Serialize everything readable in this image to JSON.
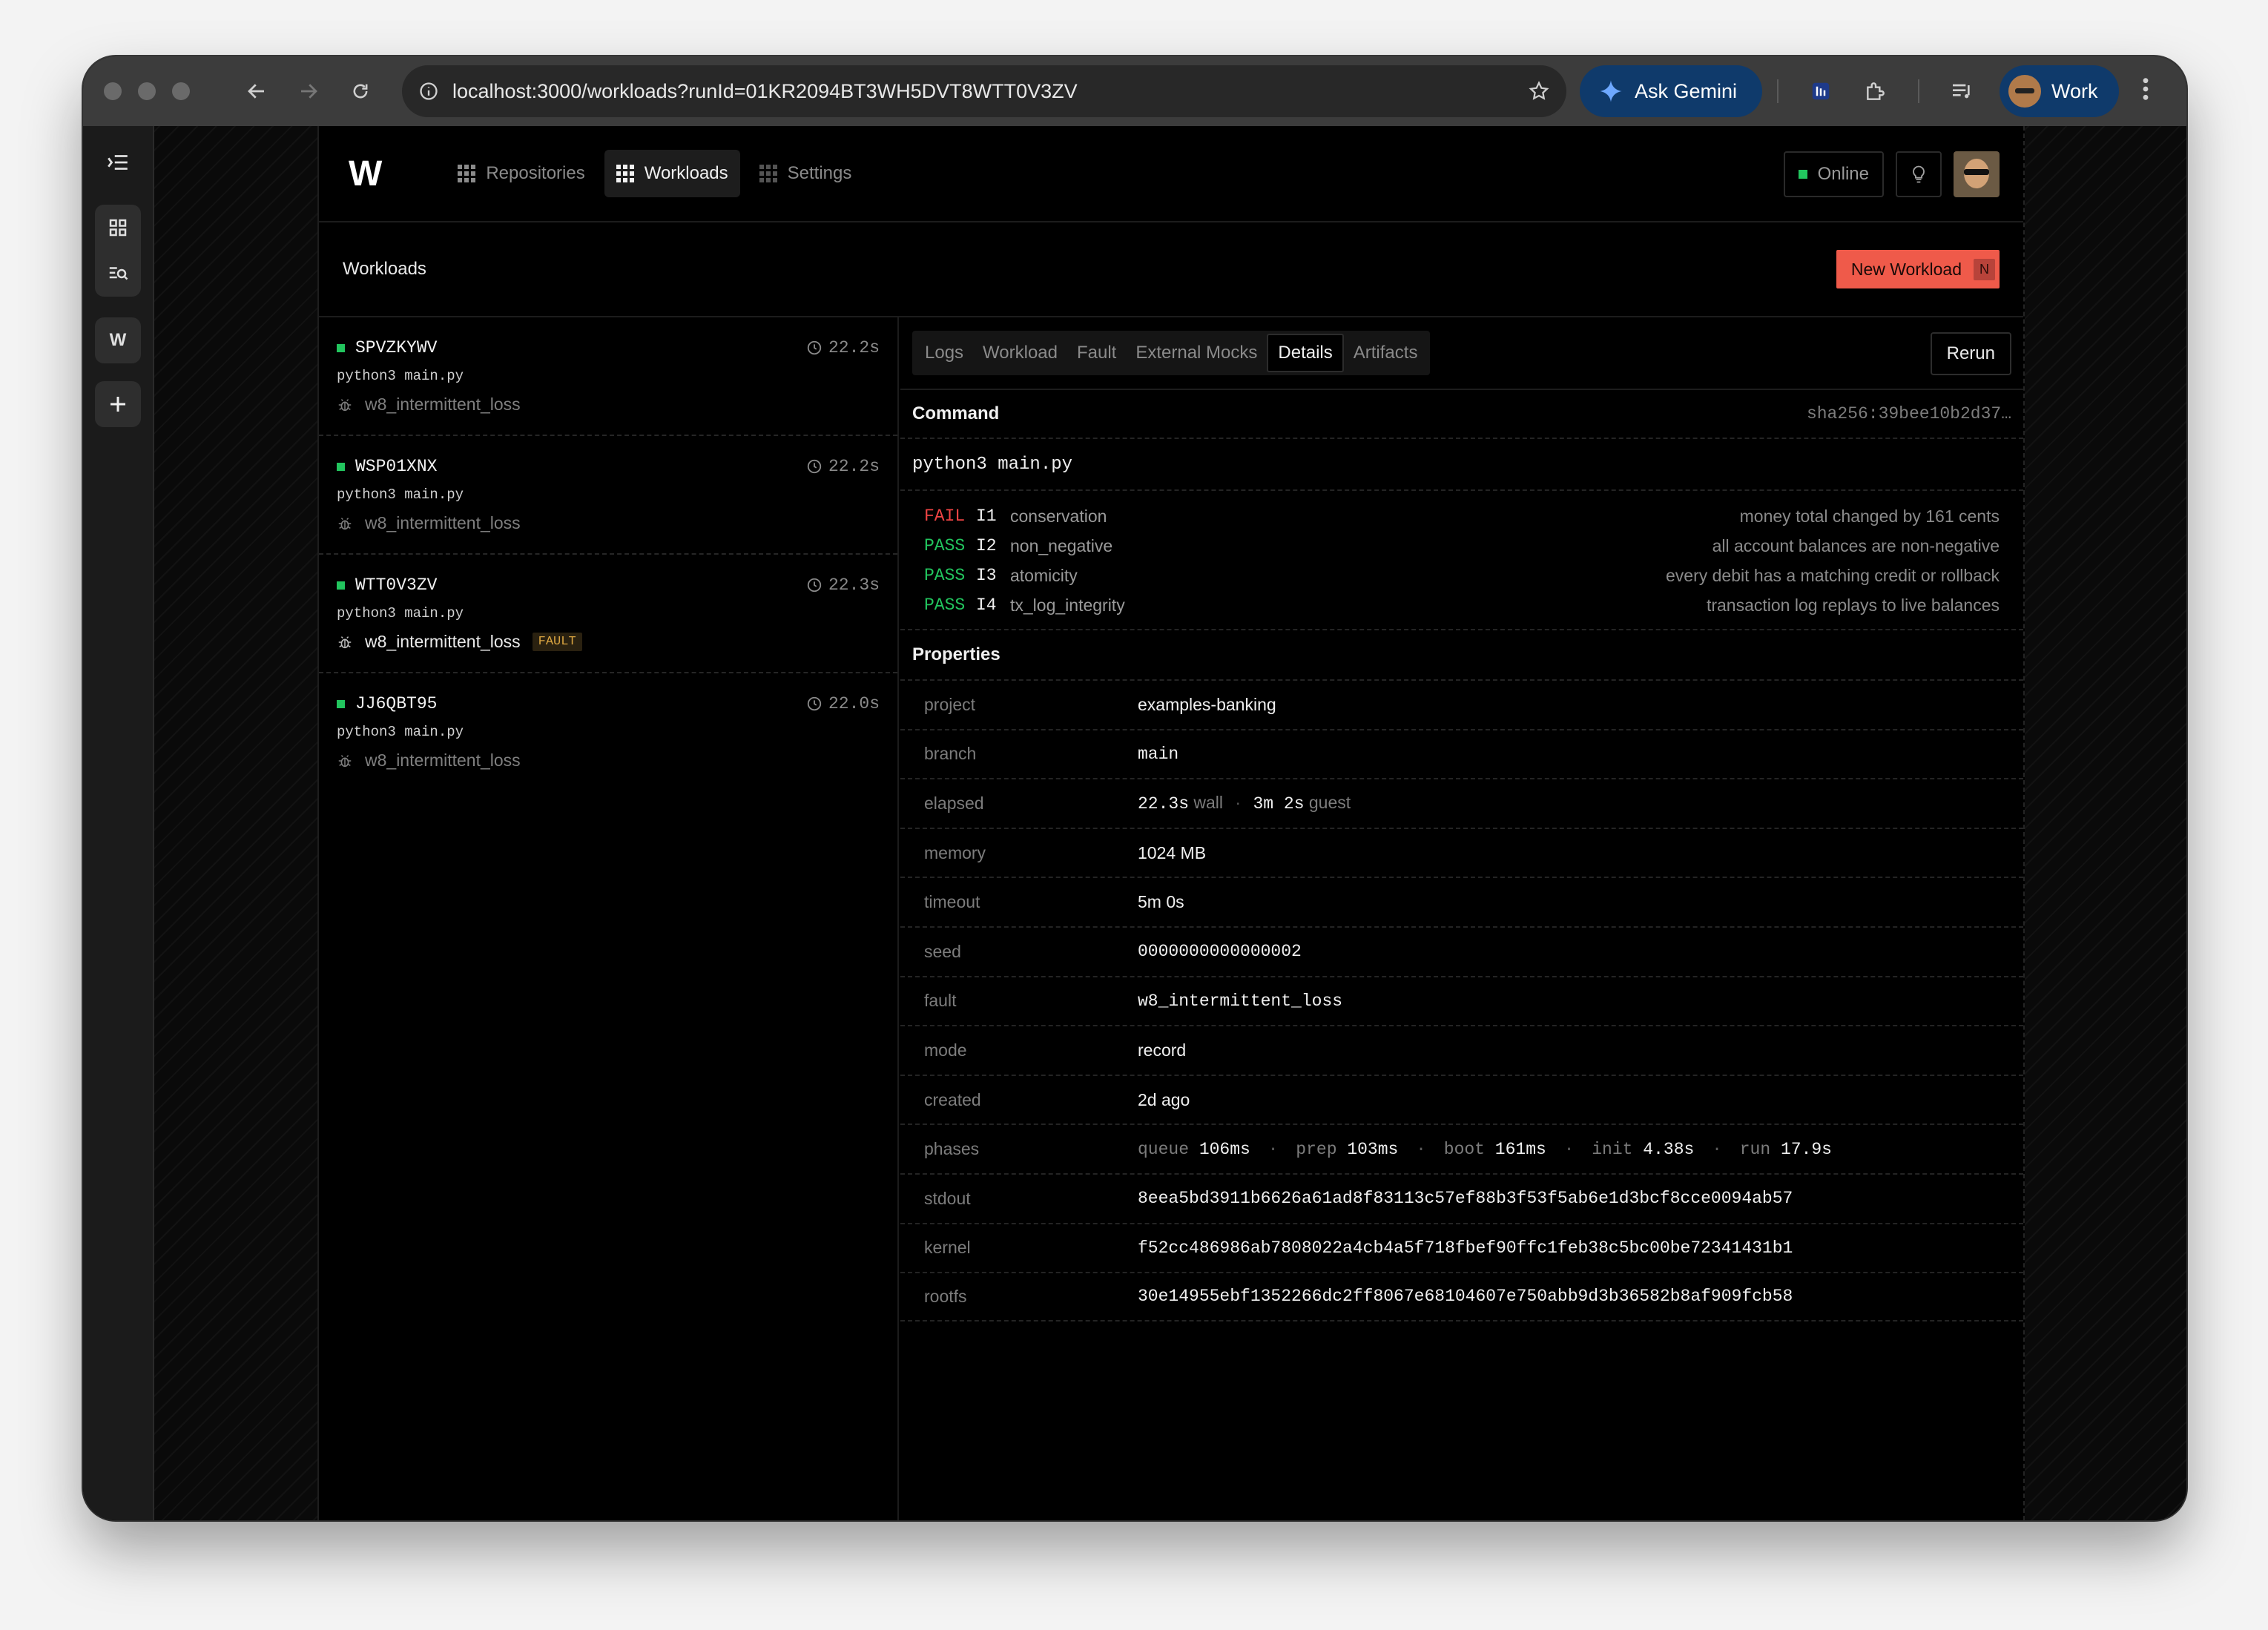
{
  "browser": {
    "url": "localhost:3000/workloads?runId=01KR2094BT3WH5DVT8WTT0V3ZV",
    "gemini_label": "Ask Gemini",
    "profile_label": "Work"
  },
  "nav": {
    "logo": "W",
    "links": [
      {
        "label": "Repositories",
        "active": false
      },
      {
        "label": "Workloads",
        "active": true
      },
      {
        "label": "Settings",
        "active": false
      }
    ],
    "status": "Online",
    "status_color": "#22c55e"
  },
  "page": {
    "title": "Workloads",
    "new_button": "New Workload",
    "new_shortcut": "N"
  },
  "workloads": [
    {
      "id": "SPVZKYWV",
      "duration": "22.2s",
      "command": "python3 main.py",
      "fault": "w8_intermittent_loss",
      "tag": ""
    },
    {
      "id": "WSP01XNX",
      "duration": "22.2s",
      "command": "python3 main.py",
      "fault": "w8_intermittent_loss",
      "tag": ""
    },
    {
      "id": "WTT0V3ZV",
      "duration": "22.3s",
      "command": "python3 main.py",
      "fault": "w8_intermittent_loss",
      "tag": "FAULT"
    },
    {
      "id": "JJ6QBT95",
      "duration": "22.0s",
      "command": "python3 main.py",
      "fault": "w8_intermittent_loss",
      "tag": ""
    }
  ],
  "details": {
    "tabs": [
      "Logs",
      "Workload",
      "Fault",
      "External Mocks",
      "Details",
      "Artifacts"
    ],
    "active_tab": "Details",
    "rerun": "Rerun",
    "command_label": "Command",
    "hash": "sha256:39bee10b2d37…",
    "command": "python3 main.py",
    "checks": [
      {
        "status": "FAIL",
        "code": "I1",
        "name": "conservation",
        "desc": "money total changed by 161 cents"
      },
      {
        "status": "PASS",
        "code": "I2",
        "name": "non_negative",
        "desc": "all account balances are non-negative"
      },
      {
        "status": "PASS",
        "code": "I3",
        "name": "atomicity",
        "desc": "every debit has a matching credit or rollback"
      },
      {
        "status": "PASS",
        "code": "I4",
        "name": "tx_log_integrity",
        "desc": "transaction log replays to live balances"
      }
    ],
    "properties_label": "Properties",
    "properties": {
      "project": {
        "key": "project",
        "value": "examples-banking"
      },
      "branch": {
        "key": "branch",
        "value": "main"
      },
      "elapsed": {
        "key": "elapsed",
        "wall": "22.3s",
        "wall_unit": "wall",
        "guest": "3m 2s",
        "guest_unit": "guest"
      },
      "memory": {
        "key": "memory",
        "value": "1024 MB"
      },
      "timeout": {
        "key": "timeout",
        "value": "5m 0s"
      },
      "seed": {
        "key": "seed",
        "value": "0000000000000002"
      },
      "fault": {
        "key": "fault",
        "value": "w8_intermittent_loss"
      },
      "mode": {
        "key": "mode",
        "value": "record"
      },
      "created": {
        "key": "created",
        "value": "2d ago"
      },
      "phases": {
        "key": "phases",
        "items": [
          {
            "name": "queue",
            "value": "106ms"
          },
          {
            "name": "prep",
            "value": "103ms"
          },
          {
            "name": "boot",
            "value": "161ms"
          },
          {
            "name": "init",
            "value": "4.38s"
          },
          {
            "name": "run",
            "value": "17.9s"
          }
        ]
      },
      "stdout": {
        "key": "stdout",
        "value": "8eea5bd3911b6626a61ad8f83113c57ef88b3f53f5ab6e1d3bcf8cce0094ab57"
      },
      "kernel": {
        "key": "kernel",
        "value": "f52cc486986ab7808022a4cb4a5f718fbef90ffc1feb38c5bc00be72341431b1"
      },
      "rootfs": {
        "key": "rootfs",
        "value": "30e14955ebf1352266dc2ff8067e68104607e750abb9d3b36582b8af909fcb58"
      }
    }
  },
  "colors": {
    "accent": "#ef5a4a",
    "pass": "#22c55e",
    "fail": "#ef4444",
    "fault_tag": "#d9a441"
  }
}
